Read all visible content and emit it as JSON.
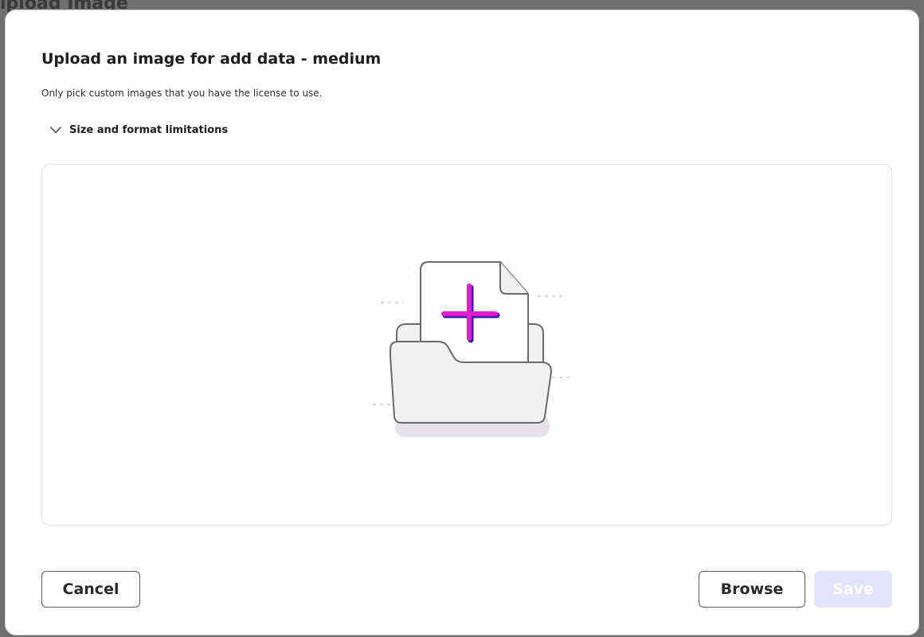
{
  "backdrop": {
    "title_fragment": "ipload Image"
  },
  "dialog": {
    "title": "Upload an image for add data - medium",
    "subtitle": "Only pick custom images that you have the license to use.",
    "limitations": {
      "label": "Size and format limitations",
      "expanded": false
    },
    "dropzone": {
      "illustration_icon": "folder-with-file-plus-icon"
    }
  },
  "footer": {
    "cancel_label": "Cancel",
    "browse_label": "Browse",
    "save_label": "Save",
    "save_disabled": true
  },
  "colors": {
    "plus_primary": "#e21bd0",
    "plus_shadow": "#3b1aa8",
    "save_disabled_bg": "#e4e4fa",
    "outline_border": "#5e5e5e"
  }
}
